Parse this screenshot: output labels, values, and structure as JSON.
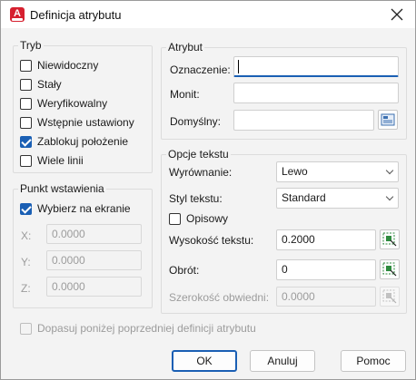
{
  "window": {
    "title": "Definicja atrybutu"
  },
  "tryb": {
    "title": "Tryb",
    "items": [
      {
        "label": "Niewidoczny",
        "checked": false
      },
      {
        "label": "Stały",
        "checked": false
      },
      {
        "label": "Weryfikowalny",
        "checked": false
      },
      {
        "label": "Wstępnie ustawiony",
        "checked": false
      },
      {
        "label": "Zablokuj położenie",
        "checked": true
      },
      {
        "label": "Wiele linii",
        "checked": false
      }
    ]
  },
  "atrybut": {
    "title": "Atrybut",
    "oznaczenie_label": "Oznaczenie:",
    "oznaczenie_value": "",
    "monit_label": "Monit:",
    "monit_value": "",
    "domyslny_label": "Domyślny:",
    "domyslny_value": ""
  },
  "punkt": {
    "title": "Punkt wstawienia",
    "wybierz_label": "Wybierz na ekranie",
    "wybierz_checked": true,
    "x_label": "X:",
    "x_value": "0.0000",
    "y_label": "Y:",
    "y_value": "0.0000",
    "z_label": "Z:",
    "z_value": "0.0000"
  },
  "opcje": {
    "title": "Opcje tekstu",
    "wyrownanie_label": "Wyrównanie:",
    "wyrownanie_value": "Lewo",
    "styl_label": "Styl tekstu:",
    "styl_value": "Standard",
    "opisowy_label": "Opisowy",
    "opisowy_checked": false,
    "wysokosc_label": "Wysokość tekstu:",
    "wysokosc_value": "0.2000",
    "obrot_label": "Obrót:",
    "obrot_value": "0",
    "szerokosc_label": "Szerokość obwiedni:",
    "szerokosc_value": "0.0000"
  },
  "dopasuj": {
    "label": "Dopasuj poniżej poprzedniej definicji atrybutu",
    "checked": false
  },
  "buttons": {
    "ok": "OK",
    "cancel": "Anuluj",
    "help": "Pomoc"
  },
  "colors": {
    "accent": "#1a5fb4",
    "app_icon": "#d6202f",
    "pick_icon": "#2e8b3e"
  }
}
